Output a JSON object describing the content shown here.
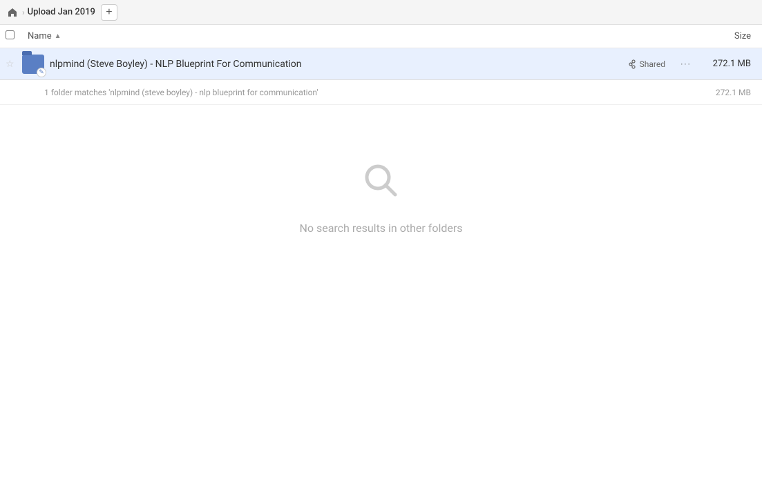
{
  "header": {
    "home_icon": "🏠",
    "chevron": "›",
    "breadcrumb_title": "Upload Jan 2019",
    "add_button_label": "+"
  },
  "columns": {
    "name_label": "Name",
    "name_sort_indicator": "▲",
    "size_label": "Size"
  },
  "file_row": {
    "star": "☆",
    "filename": "nlpmind (Steve Boyley) - NLP Blueprint For Communication",
    "shared_label": "Shared",
    "more_icon": "•••",
    "size": "272.1 MB",
    "link_icon": "🔗"
  },
  "match_summary": {
    "text": "1 folder matches 'nlpmind (steve boyley) - nlp blueprint for communication'",
    "size": "272.1 MB"
  },
  "empty_state": {
    "text": "No search results in other folders"
  }
}
